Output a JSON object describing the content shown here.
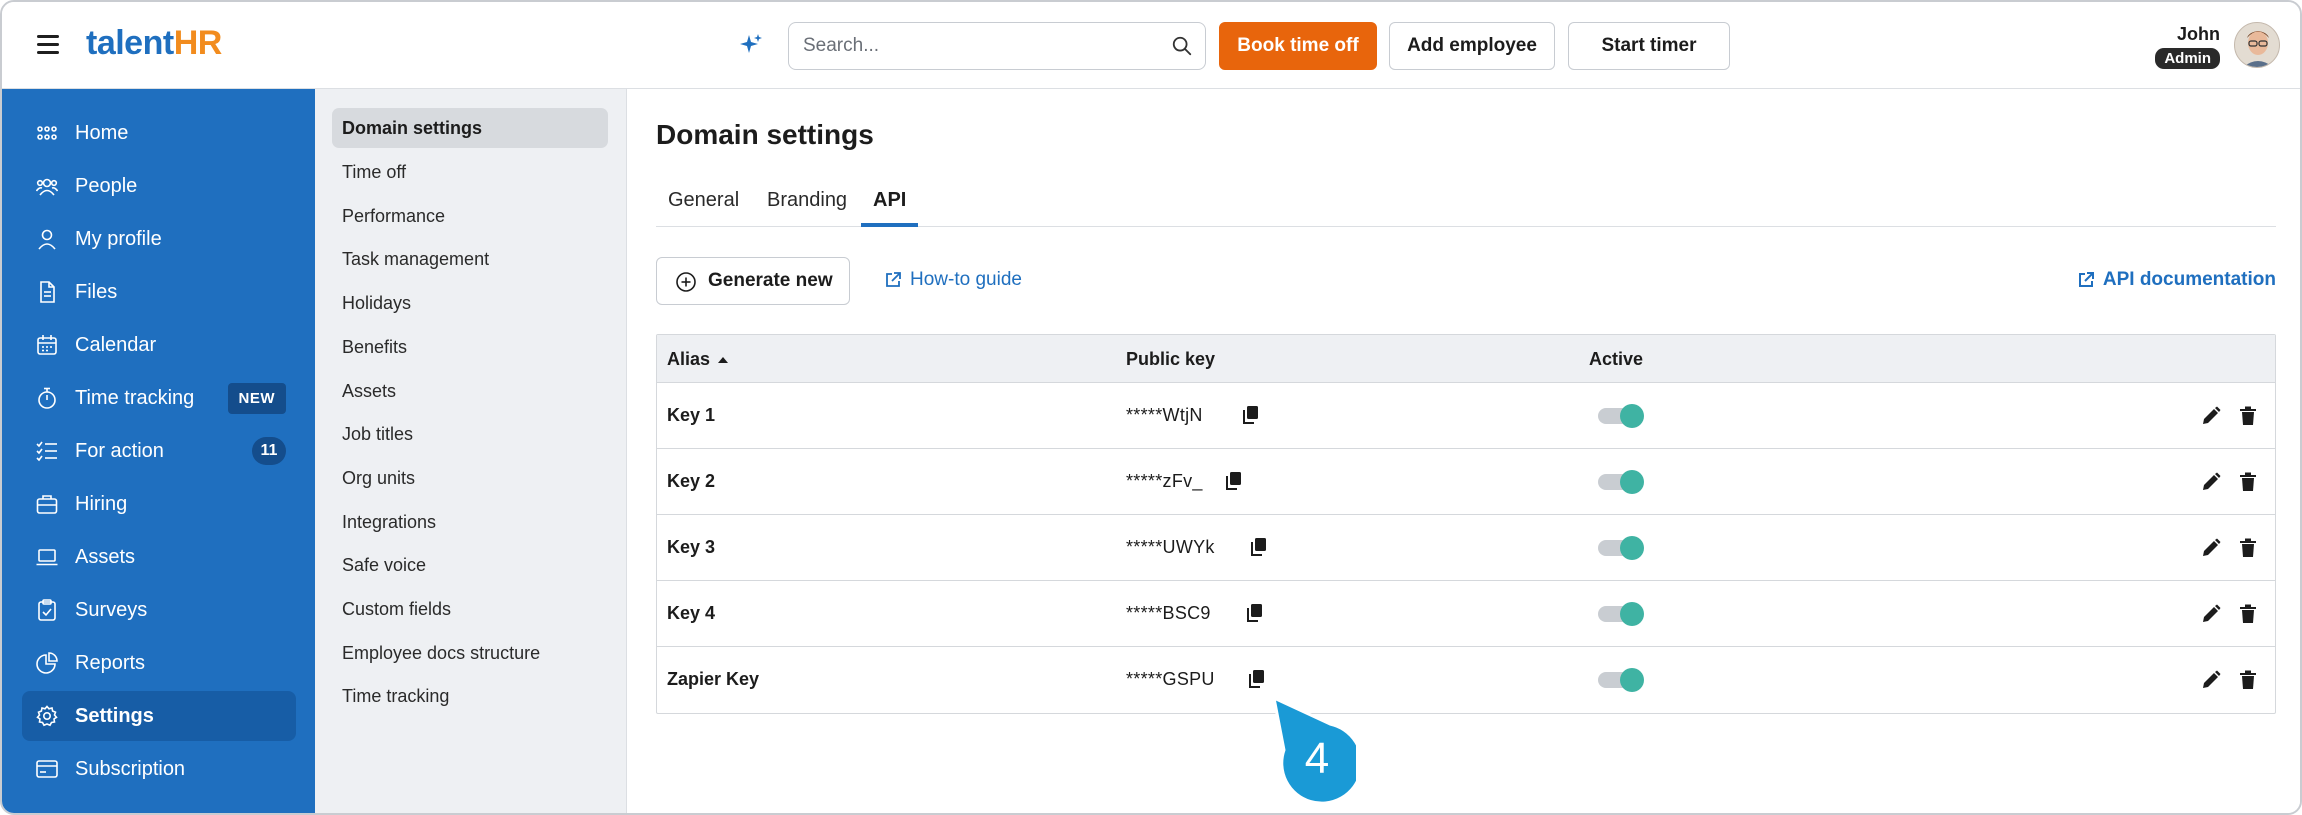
{
  "header": {
    "logo_part1": "talent",
    "logo_part2": "HR",
    "search_placeholder": "Search...",
    "book_time_off": "Book time off",
    "add_employee": "Add employee",
    "start_timer": "Start timer",
    "user_name": "John",
    "user_role": "Admin"
  },
  "sidebar": {
    "items": [
      {
        "label": "Home",
        "icon": "grid-icon"
      },
      {
        "label": "People",
        "icon": "people-icon"
      },
      {
        "label": "My profile",
        "icon": "user-icon"
      },
      {
        "label": "Files",
        "icon": "file-icon"
      },
      {
        "label": "Calendar",
        "icon": "calendar-icon"
      },
      {
        "label": "Time tracking",
        "icon": "stopwatch-icon",
        "badge": "NEW"
      },
      {
        "label": "For action",
        "icon": "checklist-icon",
        "count": "11"
      },
      {
        "label": "Hiring",
        "icon": "briefcase-icon"
      },
      {
        "label": "Assets",
        "icon": "laptop-icon"
      },
      {
        "label": "Surveys",
        "icon": "clipboard-icon"
      },
      {
        "label": "Reports",
        "icon": "pie-chart-icon"
      },
      {
        "label": "Settings",
        "icon": "gear-icon",
        "active": true
      },
      {
        "label": "Subscription",
        "icon": "card-icon"
      }
    ]
  },
  "subnav": {
    "items": [
      "Domain settings",
      "Time off",
      "Performance",
      "Task management",
      "Holidays",
      "Benefits",
      "Assets",
      "Job titles",
      "Org units",
      "Integrations",
      "Safe voice",
      "Custom fields",
      "Employee docs structure",
      "Time tracking"
    ],
    "active_index": 0
  },
  "main": {
    "title": "Domain settings",
    "tabs": [
      "General",
      "Branding",
      "API"
    ],
    "active_tab": 2,
    "generate_new": "Generate new",
    "how_to_guide": "How-to guide",
    "api_documentation": "API documentation",
    "table": {
      "columns": [
        "Alias",
        "Public key",
        "Active"
      ],
      "rows": [
        {
          "alias": "Key 1",
          "key": "*****WtjN",
          "active": true
        },
        {
          "alias": "Key 2",
          "key": "*****zFv_",
          "active": true
        },
        {
          "alias": "Key 3",
          "key": "*****UWYk",
          "active": true
        },
        {
          "alias": "Key 4",
          "key": "*****BSC9",
          "active": true
        },
        {
          "alias": "Zapier Key",
          "key": "*****GSPU",
          "active": true
        }
      ]
    }
  },
  "callout": {
    "number": "4",
    "color": "#1a9ad6"
  },
  "colors": {
    "brand_blue": "#1f6fbf",
    "brand_orange": "#e8650c",
    "toggle_on": "#3fb3a3"
  }
}
